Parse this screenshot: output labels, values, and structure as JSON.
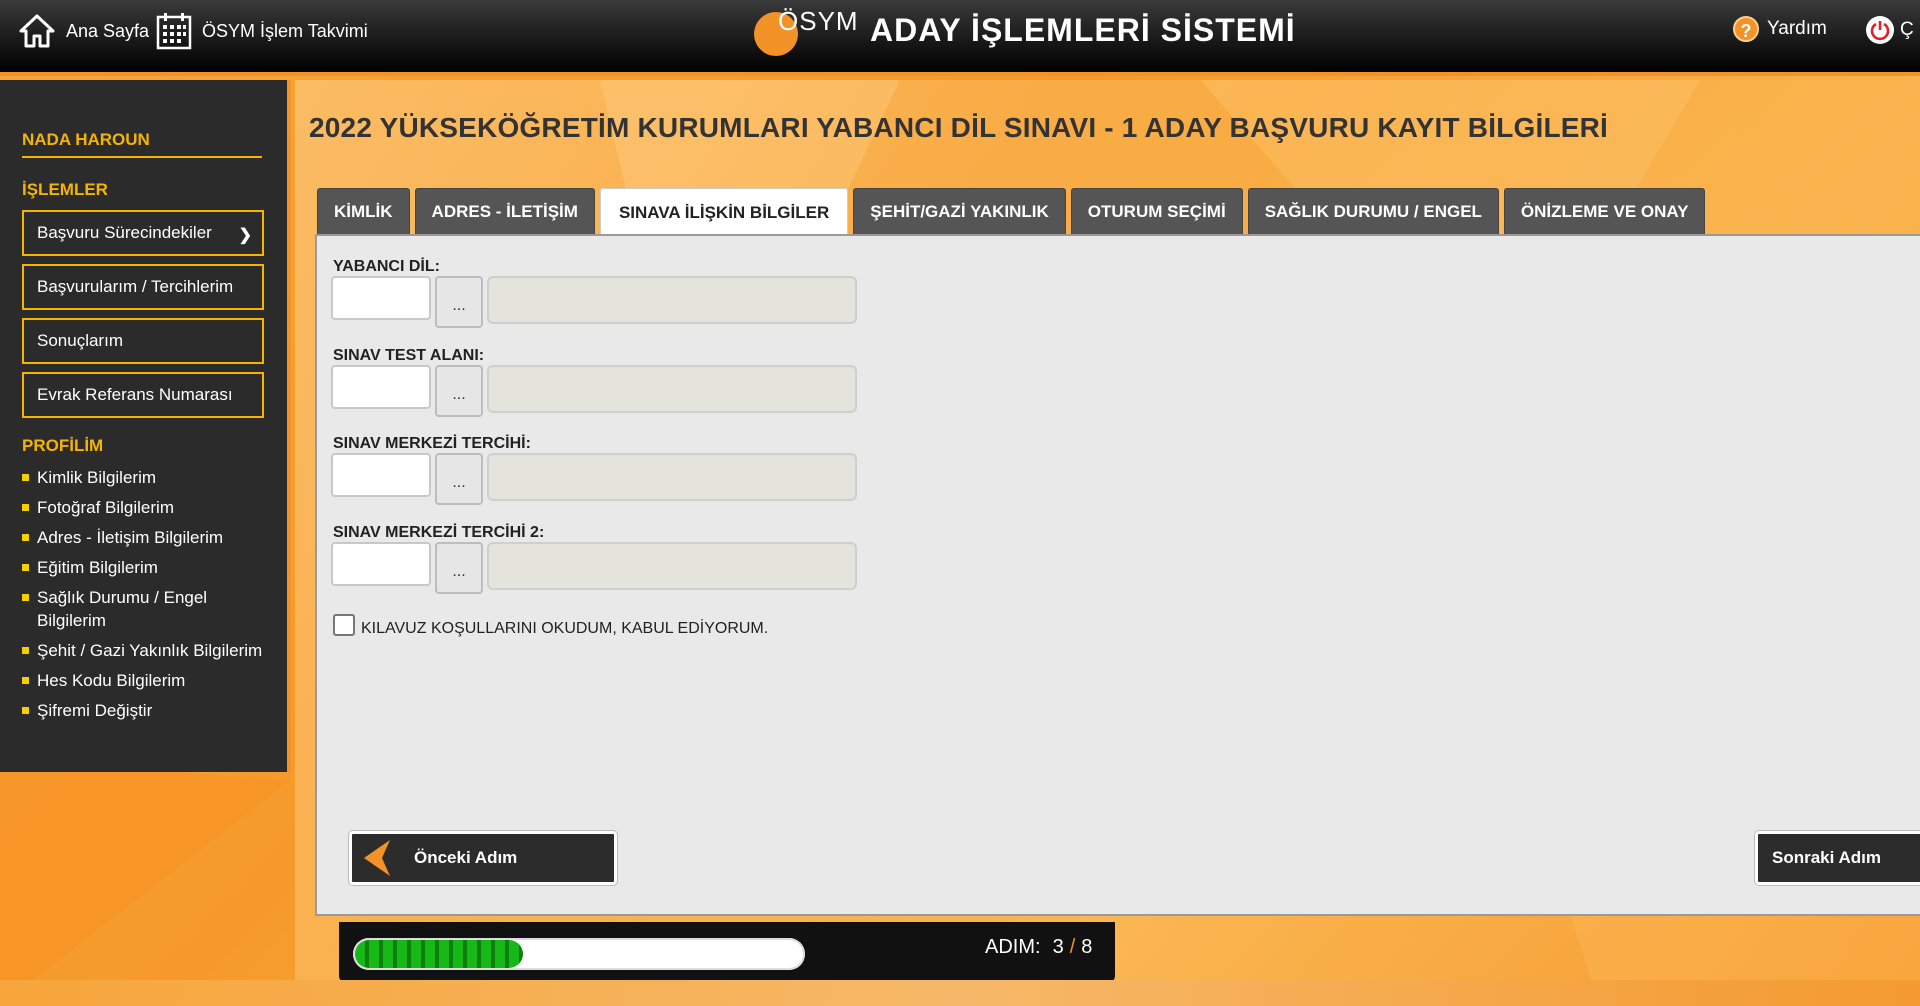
{
  "header": {
    "home_label": "Ana Sayfa",
    "calendar_label": "ÖSYM İşlem Takvimi",
    "brand_logo_text": "ÖSYM",
    "brand_title": "ADAY İŞLEMLERİ SİSTEMİ",
    "help_label": "Yardım",
    "logout_label": "Ç"
  },
  "sidebar": {
    "user_name": "NADA HAROUN",
    "operations_title": "İŞLEMLER",
    "operations": [
      {
        "label": "Başvuru Sürecindekiler"
      },
      {
        "label": "Başvurularım / Tercihlerim"
      },
      {
        "label": "Sonuçlarım"
      },
      {
        "label": "Evrak Referans Numarası"
      }
    ],
    "profile_title": "PROFİLİM",
    "profile_items": [
      "Kimlik Bilgilerim",
      "Fotoğraf Bilgilerim",
      "Adres - İletişim Bilgilerim",
      "Eğitim Bilgilerim",
      "Sağlık Durumu / Engel Bilgilerim",
      "Şehit / Gazi Yakınlık Bilgilerim",
      "Hes Kodu Bilgilerim",
      "Şifremi Değiştir"
    ]
  },
  "main": {
    "page_title": "2022 YÜKSEKÖĞRETİM KURUMLARI YABANCI DİL SINAVI - 1 ADAY BAŞVURU KAYIT BİLGİLERİ",
    "tabs": [
      {
        "label": "KİMLİK"
      },
      {
        "label": "ADRES - İLETİŞİM"
      },
      {
        "label": "SINAVA İLİŞKİN BİLGİLER"
      },
      {
        "label": "ŞEHİT/GAZİ YAKINLIK"
      },
      {
        "label": "OTURUM SEÇİMİ"
      },
      {
        "label": "SAĞLIK DURUMU / ENGEL"
      },
      {
        "label": "ÖNİZLEME VE ONAY"
      }
    ],
    "active_tab": "SINAVA İLİŞKİN BİLGİLER",
    "fields": [
      {
        "label": "YABANCI DİL:",
        "code": "",
        "name": "",
        "lookup_label": "..."
      },
      {
        "label": "SINAV TEST ALANI:",
        "code": "",
        "name": "",
        "lookup_label": "..."
      },
      {
        "label": "SINAV MERKEZİ TERCİHİ:",
        "code": "",
        "name": "",
        "lookup_label": "..."
      },
      {
        "label": "SINAV MERKEZİ TERCİHİ 2:",
        "code": "",
        "name": "",
        "lookup_label": "..."
      }
    ],
    "agreement_label": "KILAVUZ KOŞULLARINI OKUDUM, KABUL EDİYORUM.",
    "agreement_checked": false,
    "prev_label": "Önceki Adım",
    "next_label": "Sonraki Adım"
  },
  "progress": {
    "step_label": "ADIM:",
    "current": "3",
    "separator": "/",
    "total": "8",
    "fraction": 0.375
  },
  "colors": {
    "accent": "#f39327",
    "sidebar_highlight": "#f5b400",
    "progress_green": "#17b817"
  }
}
